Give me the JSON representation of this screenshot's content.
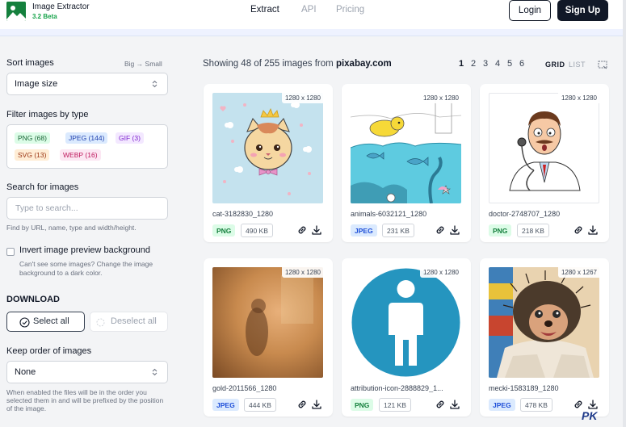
{
  "header": {
    "app_title": "Image Extractor",
    "app_version": "3.2 Beta",
    "nav": [
      "Extract",
      "API",
      "Pricing"
    ],
    "login_label": "Login",
    "signup_label": "Sign Up"
  },
  "sidebar": {
    "sort_label": "Sort images",
    "sort_hint_big": "Big",
    "sort_hint_small": "Small",
    "sort_value": "Image size",
    "filter_label": "Filter images by type",
    "filters": [
      {
        "type": "PNG",
        "count": "68"
      },
      {
        "type": "JPEG",
        "count": "144"
      },
      {
        "type": "GIF",
        "count": "3"
      },
      {
        "type": "SVG",
        "count": "13"
      },
      {
        "type": "WEBP",
        "count": "16"
      }
    ],
    "search_label": "Search for images",
    "search_placeholder": "Type to search...",
    "search_hint": "Find by URL, name, type and width/height.",
    "invert_label": "Invert image preview background",
    "invert_hint_1": "Can't see some images? Change the image",
    "invert_hint_2": "background to a dark color.",
    "download_heading": "DOWNLOAD",
    "select_all_label": "Select all",
    "deselect_all_label": "Deselect all",
    "keep_order_label": "Keep order of images",
    "keep_order_value": "None",
    "keep_order_hint_1": "When enabled the files will be in the order you",
    "keep_order_hint_2": "selected them in and will be prefixed by the position",
    "keep_order_hint_3": "of the image."
  },
  "main": {
    "showing_prefix": "Showing 48 of 255 images from",
    "source": "pixabay.com",
    "pages": [
      "1",
      "2",
      "3",
      "4",
      "5",
      "6"
    ],
    "current_page": "1",
    "view_grid": "GRID",
    "view_list": "LIST",
    "cards": [
      {
        "name": "cat-3182830_1280",
        "dims": "1280 x 1280",
        "type": "PNG",
        "size": "490 KB"
      },
      {
        "name": "animals-6032121_1280",
        "dims": "1280 x 1280",
        "type": "JPEG",
        "size": "231 KB"
      },
      {
        "name": "doctor-2748707_1280",
        "dims": "1280 x 1280",
        "type": "PNG",
        "size": "218 KB"
      },
      {
        "name": "gold-2011566_1280",
        "dims": "1280 x 1280",
        "type": "JPEG",
        "size": "444 KB"
      },
      {
        "name": "attribution-icon-2888829_1...",
        "dims": "1280 x 1280",
        "type": "PNG",
        "size": "121 KB"
      },
      {
        "name": "mecki-1583189_1280",
        "dims": "1280 x 1267",
        "type": "JPEG",
        "size": "478 KB"
      }
    ]
  },
  "watermark": "PK",
  "colors": {
    "accent": "#111827",
    "png": "#15803d",
    "jpeg": "#1d4ed8",
    "brand": "#15803d"
  }
}
